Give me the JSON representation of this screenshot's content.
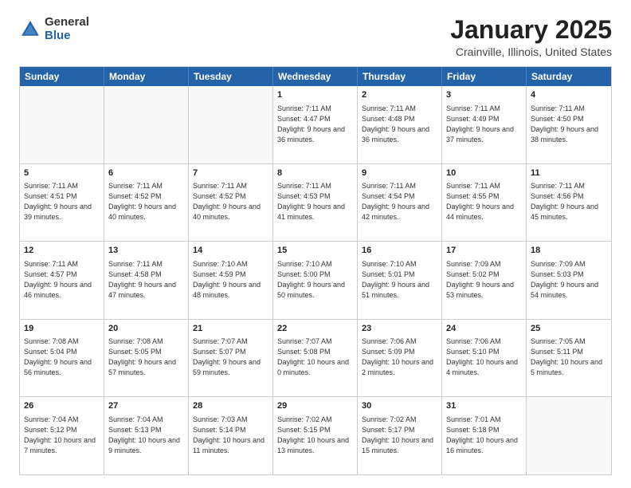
{
  "logo": {
    "general": "General",
    "blue": "Blue"
  },
  "title": {
    "month": "January 2025",
    "location": "Crainville, Illinois, United States"
  },
  "weekdays": [
    "Sunday",
    "Monday",
    "Tuesday",
    "Wednesday",
    "Thursday",
    "Friday",
    "Saturday"
  ],
  "weeks": [
    [
      {
        "day": "",
        "sunrise": "",
        "sunset": "",
        "daylight": "",
        "empty": true
      },
      {
        "day": "",
        "sunrise": "",
        "sunset": "",
        "daylight": "",
        "empty": true
      },
      {
        "day": "",
        "sunrise": "",
        "sunset": "",
        "daylight": "",
        "empty": true
      },
      {
        "day": "1",
        "sunrise": "Sunrise: 7:11 AM",
        "sunset": "Sunset: 4:47 PM",
        "daylight": "Daylight: 9 hours and 36 minutes.",
        "empty": false
      },
      {
        "day": "2",
        "sunrise": "Sunrise: 7:11 AM",
        "sunset": "Sunset: 4:48 PM",
        "daylight": "Daylight: 9 hours and 36 minutes.",
        "empty": false
      },
      {
        "day": "3",
        "sunrise": "Sunrise: 7:11 AM",
        "sunset": "Sunset: 4:49 PM",
        "daylight": "Daylight: 9 hours and 37 minutes.",
        "empty": false
      },
      {
        "day": "4",
        "sunrise": "Sunrise: 7:11 AM",
        "sunset": "Sunset: 4:50 PM",
        "daylight": "Daylight: 9 hours and 38 minutes.",
        "empty": false
      }
    ],
    [
      {
        "day": "5",
        "sunrise": "Sunrise: 7:11 AM",
        "sunset": "Sunset: 4:51 PM",
        "daylight": "Daylight: 9 hours and 39 minutes.",
        "empty": false
      },
      {
        "day": "6",
        "sunrise": "Sunrise: 7:11 AM",
        "sunset": "Sunset: 4:52 PM",
        "daylight": "Daylight: 9 hours and 40 minutes.",
        "empty": false
      },
      {
        "day": "7",
        "sunrise": "Sunrise: 7:11 AM",
        "sunset": "Sunset: 4:52 PM",
        "daylight": "Daylight: 9 hours and 40 minutes.",
        "empty": false
      },
      {
        "day": "8",
        "sunrise": "Sunrise: 7:11 AM",
        "sunset": "Sunset: 4:53 PM",
        "daylight": "Daylight: 9 hours and 41 minutes.",
        "empty": false
      },
      {
        "day": "9",
        "sunrise": "Sunrise: 7:11 AM",
        "sunset": "Sunset: 4:54 PM",
        "daylight": "Daylight: 9 hours and 42 minutes.",
        "empty": false
      },
      {
        "day": "10",
        "sunrise": "Sunrise: 7:11 AM",
        "sunset": "Sunset: 4:55 PM",
        "daylight": "Daylight: 9 hours and 44 minutes.",
        "empty": false
      },
      {
        "day": "11",
        "sunrise": "Sunrise: 7:11 AM",
        "sunset": "Sunset: 4:56 PM",
        "daylight": "Daylight: 9 hours and 45 minutes.",
        "empty": false
      }
    ],
    [
      {
        "day": "12",
        "sunrise": "Sunrise: 7:11 AM",
        "sunset": "Sunset: 4:57 PM",
        "daylight": "Daylight: 9 hours and 46 minutes.",
        "empty": false
      },
      {
        "day": "13",
        "sunrise": "Sunrise: 7:11 AM",
        "sunset": "Sunset: 4:58 PM",
        "daylight": "Daylight: 9 hours and 47 minutes.",
        "empty": false
      },
      {
        "day": "14",
        "sunrise": "Sunrise: 7:10 AM",
        "sunset": "Sunset: 4:59 PM",
        "daylight": "Daylight: 9 hours and 48 minutes.",
        "empty": false
      },
      {
        "day": "15",
        "sunrise": "Sunrise: 7:10 AM",
        "sunset": "Sunset: 5:00 PM",
        "daylight": "Daylight: 9 hours and 50 minutes.",
        "empty": false
      },
      {
        "day": "16",
        "sunrise": "Sunrise: 7:10 AM",
        "sunset": "Sunset: 5:01 PM",
        "daylight": "Daylight: 9 hours and 51 minutes.",
        "empty": false
      },
      {
        "day": "17",
        "sunrise": "Sunrise: 7:09 AM",
        "sunset": "Sunset: 5:02 PM",
        "daylight": "Daylight: 9 hours and 53 minutes.",
        "empty": false
      },
      {
        "day": "18",
        "sunrise": "Sunrise: 7:09 AM",
        "sunset": "Sunset: 5:03 PM",
        "daylight": "Daylight: 9 hours and 54 minutes.",
        "empty": false
      }
    ],
    [
      {
        "day": "19",
        "sunrise": "Sunrise: 7:08 AM",
        "sunset": "Sunset: 5:04 PM",
        "daylight": "Daylight: 9 hours and 56 minutes.",
        "empty": false
      },
      {
        "day": "20",
        "sunrise": "Sunrise: 7:08 AM",
        "sunset": "Sunset: 5:05 PM",
        "daylight": "Daylight: 9 hours and 57 minutes.",
        "empty": false
      },
      {
        "day": "21",
        "sunrise": "Sunrise: 7:07 AM",
        "sunset": "Sunset: 5:07 PM",
        "daylight": "Daylight: 9 hours and 59 minutes.",
        "empty": false
      },
      {
        "day": "22",
        "sunrise": "Sunrise: 7:07 AM",
        "sunset": "Sunset: 5:08 PM",
        "daylight": "Daylight: 10 hours and 0 minutes.",
        "empty": false
      },
      {
        "day": "23",
        "sunrise": "Sunrise: 7:06 AM",
        "sunset": "Sunset: 5:09 PM",
        "daylight": "Daylight: 10 hours and 2 minutes.",
        "empty": false
      },
      {
        "day": "24",
        "sunrise": "Sunrise: 7:06 AM",
        "sunset": "Sunset: 5:10 PM",
        "daylight": "Daylight: 10 hours and 4 minutes.",
        "empty": false
      },
      {
        "day": "25",
        "sunrise": "Sunrise: 7:05 AM",
        "sunset": "Sunset: 5:11 PM",
        "daylight": "Daylight: 10 hours and 5 minutes.",
        "empty": false
      }
    ],
    [
      {
        "day": "26",
        "sunrise": "Sunrise: 7:04 AM",
        "sunset": "Sunset: 5:12 PM",
        "daylight": "Daylight: 10 hours and 7 minutes.",
        "empty": false
      },
      {
        "day": "27",
        "sunrise": "Sunrise: 7:04 AM",
        "sunset": "Sunset: 5:13 PM",
        "daylight": "Daylight: 10 hours and 9 minutes.",
        "empty": false
      },
      {
        "day": "28",
        "sunrise": "Sunrise: 7:03 AM",
        "sunset": "Sunset: 5:14 PM",
        "daylight": "Daylight: 10 hours and 11 minutes.",
        "empty": false
      },
      {
        "day": "29",
        "sunrise": "Sunrise: 7:02 AM",
        "sunset": "Sunset: 5:15 PM",
        "daylight": "Daylight: 10 hours and 13 minutes.",
        "empty": false
      },
      {
        "day": "30",
        "sunrise": "Sunrise: 7:02 AM",
        "sunset": "Sunset: 5:17 PM",
        "daylight": "Daylight: 10 hours and 15 minutes.",
        "empty": false
      },
      {
        "day": "31",
        "sunrise": "Sunrise: 7:01 AM",
        "sunset": "Sunset: 5:18 PM",
        "daylight": "Daylight: 10 hours and 16 minutes.",
        "empty": false
      },
      {
        "day": "",
        "sunrise": "",
        "sunset": "",
        "daylight": "",
        "empty": true
      }
    ]
  ]
}
